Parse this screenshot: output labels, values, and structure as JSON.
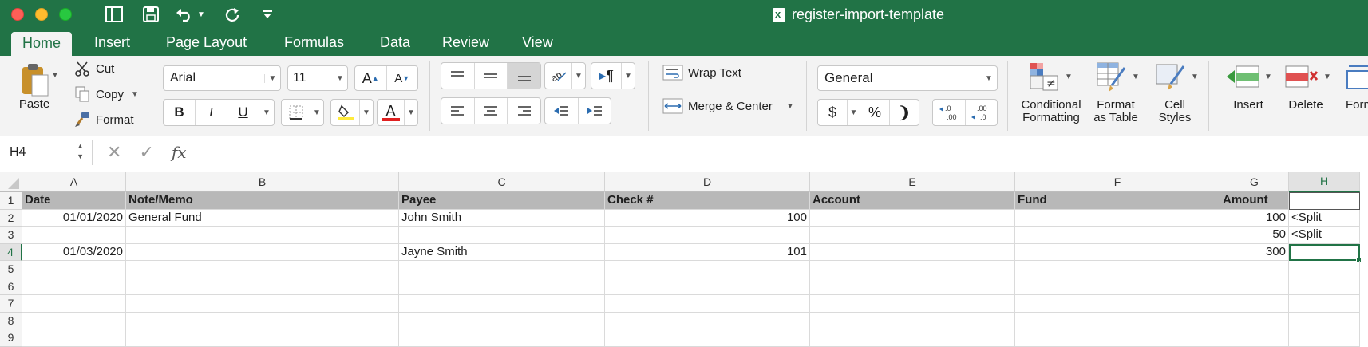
{
  "window": {
    "title": "register-import-template"
  },
  "tabs": [
    "Home",
    "Insert",
    "Page Layout",
    "Formulas",
    "Data",
    "Review",
    "View"
  ],
  "active_tab": "Home",
  "ribbon": {
    "paste": "Paste",
    "cut": "Cut",
    "copy": "Copy",
    "format": "Format",
    "font_name": "Arial",
    "font_size": "11",
    "bold": "B",
    "italic": "I",
    "underline": "U",
    "font_color_letter": "A",
    "wrap_text": "Wrap Text",
    "merge_center": "Merge & Center",
    "number_format": "General",
    "currency": "$",
    "percent": "%",
    "conditional_formatting_1": "Conditional",
    "conditional_formatting_2": "Formatting",
    "format_as_table_1": "Format",
    "format_as_table_2": "as Table",
    "cell_styles_1": "Cell",
    "cell_styles_2": "Styles",
    "insert": "Insert",
    "delete": "Delete",
    "format_cells": "Form",
    "highlight_color": "#ffeb3b",
    "font_color": "#e02020"
  },
  "formula_bar": {
    "name_box": "H4",
    "formula": ""
  },
  "sheet": {
    "columns": [
      "A",
      "B",
      "C",
      "D",
      "E",
      "F",
      "G",
      "H"
    ],
    "row_numbers": [
      "1",
      "2",
      "3",
      "4",
      "5",
      "6",
      "7",
      "8",
      "9"
    ],
    "selected_cell": "H4",
    "rows": [
      [
        "Date",
        "Note/Memo",
        "Payee",
        "Check #",
        "Account",
        "Fund",
        "Amount",
        ""
      ],
      [
        "01/01/2020",
        "General Fund",
        "John Smith",
        "100",
        "",
        "",
        "100",
        "<Split"
      ],
      [
        "",
        "",
        "",
        "",
        "",
        "",
        "50",
        "<Split"
      ],
      [
        "01/03/2020",
        "",
        "Jayne Smith",
        "101",
        "",
        "",
        "300",
        ""
      ],
      [
        "",
        "",
        "",
        "",
        "",
        "",
        "",
        ""
      ],
      [
        "",
        "",
        "",
        "",
        "",
        "",
        "",
        ""
      ],
      [
        "",
        "",
        "",
        "",
        "",
        "",
        "",
        ""
      ],
      [
        "",
        "",
        "",
        "",
        "",
        "",
        "",
        ""
      ],
      [
        "",
        "",
        "",
        "",
        "",
        "",
        "",
        ""
      ]
    ]
  }
}
